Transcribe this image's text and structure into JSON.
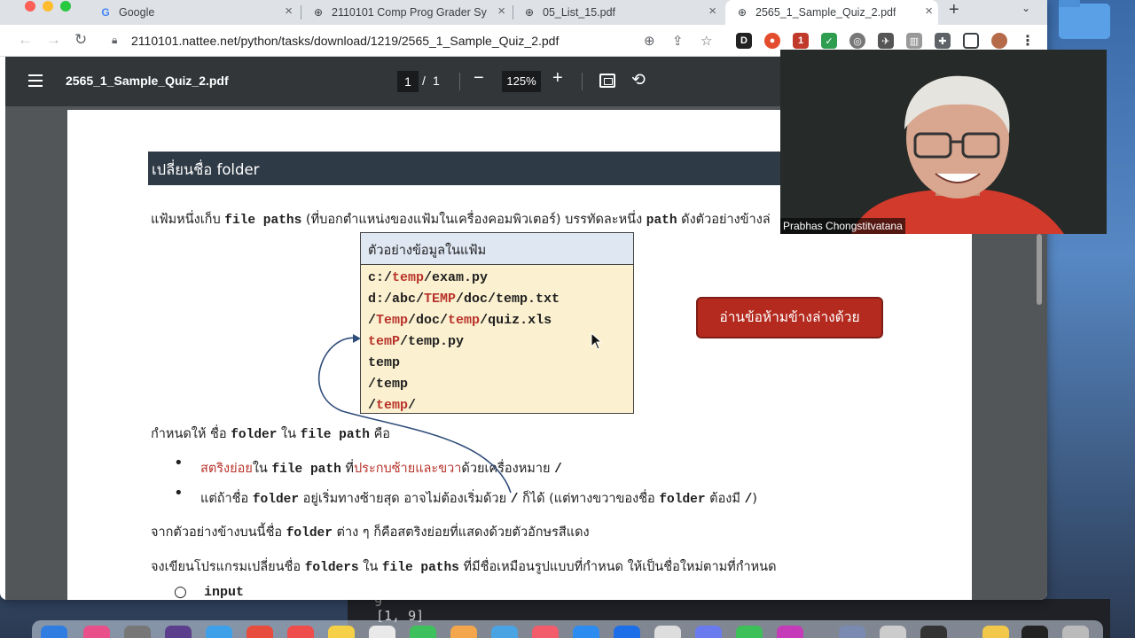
{
  "browser": {
    "tabs": [
      {
        "label": "Google",
        "icon": "google-icon",
        "active": false
      },
      {
        "label": "2110101 Comp Prog Grader Sy",
        "icon": "globe-icon",
        "active": false
      },
      {
        "label": "05_List_15.pdf",
        "icon": "globe-icon",
        "active": false
      },
      {
        "label": "2565_1_Sample_Quiz_2.pdf",
        "icon": "globe-icon",
        "active": true
      }
    ],
    "url": "2110101.nattee.net/python/tasks/download/1219/2565_1_Sample_Quiz_2.pdf",
    "extensions_badge": "1"
  },
  "pdf": {
    "title": "2565_1_Sample_Quiz_2.pdf",
    "current_page": "1",
    "separator": "/",
    "total_pages": "1",
    "zoom": "125%"
  },
  "document": {
    "section_title": "เปลี่ยนชื่อ folder",
    "intro": {
      "t1": "แฟ้มหนึ่งเก็บ ",
      "t2": "file paths",
      "t3": " (ที่บอกตำแหน่งของแฟ้มในเครื่องคอมพิวเตอร์) บรรทัดละหนึ่ง ",
      "t4": "path",
      "t5": " ดังตัวอย่างข้างล่"
    },
    "example": {
      "header": "ตัวอย่างข้อมูลในแฟ้ม",
      "lines": [
        [
          {
            "t": "c:/",
            "red": false
          },
          {
            "t": "temp",
            "red": true
          },
          {
            "t": "/exam.py",
            "red": false
          }
        ],
        [
          {
            "t": "d:/abc/",
            "red": false
          },
          {
            "t": "TEMP",
            "red": true
          },
          {
            "t": "/doc/temp.txt",
            "red": false
          }
        ],
        [
          {
            "t": "/",
            "red": false
          },
          {
            "t": "Temp",
            "red": true
          },
          {
            "t": "/doc/",
            "red": false
          },
          {
            "t": "temp",
            "red": true
          },
          {
            "t": "/quiz.xls",
            "red": false
          }
        ],
        [
          {
            "t": "temP",
            "red": true
          },
          {
            "t": "/temp.py",
            "red": false
          }
        ],
        [
          {
            "t": "temp",
            "red": false
          }
        ],
        [
          {
            "t": "/temp",
            "red": false
          }
        ],
        [
          {
            "t": "/",
            "red": false
          },
          {
            "t": "temp",
            "red": true
          },
          {
            "t": "/",
            "red": false
          }
        ]
      ]
    },
    "warn_button": "อ่านข้อห้ามข้างล่างด้วย",
    "rule": {
      "t1": "กำหนดให้ ชื่อ ",
      "t2": "folder",
      "t3": " ใน ",
      "t4": "file path",
      "t5": " คือ"
    },
    "bullet1": {
      "t1": "สตริงย่อย",
      "t2": "ใน ",
      "t3": "file path",
      "t4": " ที่",
      "t5": "ประกบซ้ายและขวา",
      "t6": "ด้วยเครื่องหมาย ",
      "t7": "/"
    },
    "bullet2": {
      "t1": "แต่ถ้าชื่อ ",
      "t2": "folder",
      "t3": " อยู่เริ่มทางซ้ายสุด อาจไม่ต้องเริ่มด้วย ",
      "t4": "/",
      "t5": " ก็ได้ (แต่ทางขวาของชื่อ ",
      "t6": "folder",
      "t7": " ต้องมี ",
      "t8": "/",
      "t9": ")"
    },
    "note": {
      "t1": "จากตัวอย่างข้างบนนี้ชื่อ ",
      "t2": "folder",
      "t3": " ต่าง ๆ ก็คือสตริงย่อยที่แสดงด้วยตัวอักษรสีแดง"
    },
    "task": {
      "t1": "จงเขียนโปรแกรมเปลี่ยนชื่อ ",
      "t2": "folders",
      "t3": " ใน ",
      "t4": "file paths",
      "t5": "  ที่มีชื่อเหมือนรูปแบบที่กำหนด ให้เป็นชื่อใหม่ตามที่กำหนด"
    },
    "sub_bullet": "input"
  },
  "webcam": {
    "name": "Prabhas Chongstitvatana"
  },
  "terminal_peek": {
    "line": "[1, 9]"
  },
  "colors": {
    "accent_red": "#b8332b",
    "section_bar": "#2e3a45",
    "example_bg": "#fbf0cf",
    "example_header": "#dfe7f2",
    "button_red": "#b42a1f"
  }
}
